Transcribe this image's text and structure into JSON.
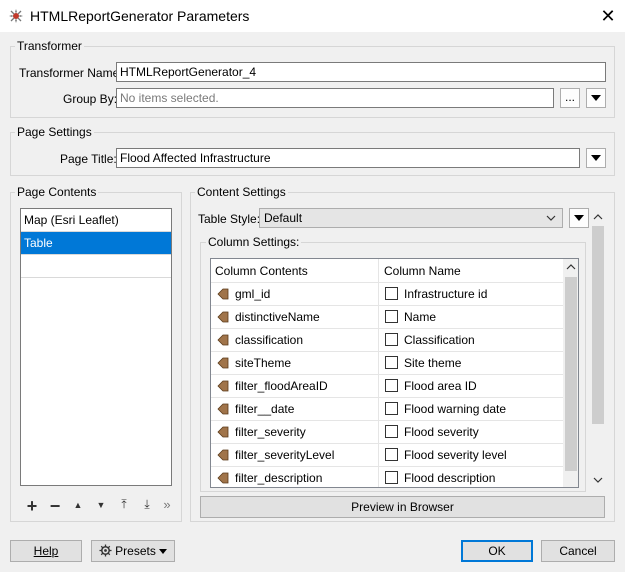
{
  "window": {
    "title": "HTMLReportGenerator Parameters",
    "close_glyph": "✕"
  },
  "transformer": {
    "group_label": "Transformer",
    "name_label": "Transformer Name:",
    "name_value": "HTMLReportGenerator_4",
    "group_by_label": "Group By:",
    "group_by_placeholder": "No items selected.",
    "ellipsis_label": "..."
  },
  "page_settings": {
    "group_label": "Page Settings",
    "title_label": "Page Title:",
    "title_value": "Flood Affected Infrastructure"
  },
  "page_contents": {
    "group_label": "Page Contents",
    "items": [
      {
        "label": "Map (Esri Leaflet)",
        "selected": false
      },
      {
        "label": "Table",
        "selected": true
      },
      {
        "label": "",
        "selected": false
      }
    ],
    "toolbar": {
      "add": "+",
      "remove": "−",
      "move_up": "▲",
      "move_down": "▼",
      "move_top": "⤒",
      "move_bottom": "⤓",
      "more": "»"
    }
  },
  "content_settings": {
    "group_label": "Content Settings",
    "table_style_label": "Table Style:",
    "table_style_value": "Default",
    "column_settings_label": "Column Settings:",
    "columns": {
      "contents_header": "Column Contents",
      "name_header": "Column Name"
    },
    "rows": [
      {
        "contents": "gml_id",
        "name": "Infrastructure id"
      },
      {
        "contents": "distinctiveName",
        "name": "Name"
      },
      {
        "contents": "classification",
        "name": "Classification"
      },
      {
        "contents": "siteTheme",
        "name": "Site theme"
      },
      {
        "contents": "filter_floodAreaID",
        "name": "Flood area ID"
      },
      {
        "contents": "filter__date",
        "name": "Flood warning date"
      },
      {
        "contents": "filter_severity",
        "name": "Flood severity"
      },
      {
        "contents": "filter_severityLevel",
        "name": "Flood severity level"
      },
      {
        "contents": "filter_description",
        "name": "Flood description"
      }
    ],
    "preview_label": "Preview in Browser"
  },
  "footer": {
    "help_label": "Help",
    "presets_label": "Presets",
    "ok_label": "OK",
    "cancel_label": "Cancel"
  },
  "colors": {
    "selection": "#0078d7",
    "attr_icon": "#a0744a",
    "window_bg": "#f0f0f0"
  }
}
